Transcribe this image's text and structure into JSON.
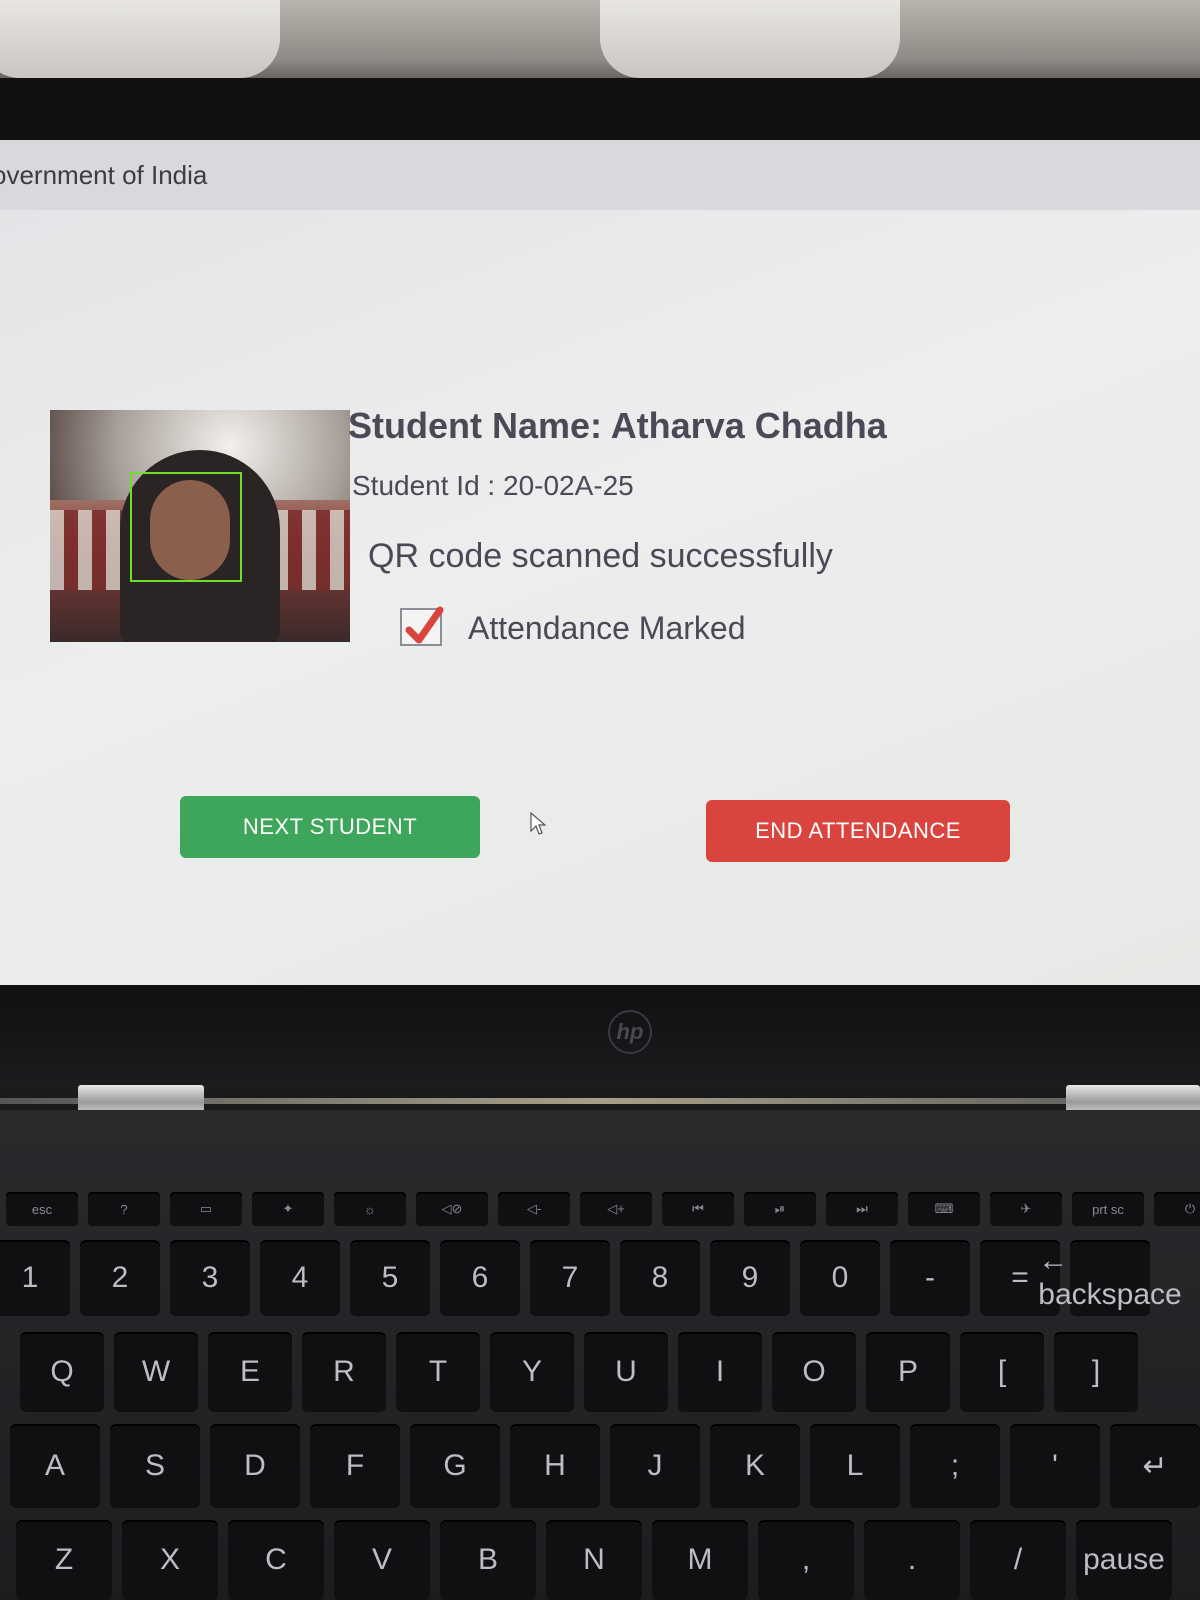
{
  "header": {
    "title": "overnment of India"
  },
  "student": {
    "name_line": "Student Name: Atharva Chadha",
    "id_line": "Student Id : 20-02A-25"
  },
  "status": {
    "qr_message": "QR code scanned successfully",
    "attendance_label": "Attendance Marked",
    "attendance_checked": true
  },
  "actions": {
    "next_label": "NEXT STUDENT",
    "end_label": "END ATTENDANCE"
  },
  "colors": {
    "next_button": "#3ea65a",
    "end_button": "#d9443e",
    "face_box": "#6ee02c",
    "check_mark": "#d9443e"
  },
  "keyboard": {
    "fn_row": [
      "esc",
      "?",
      "▭",
      "✦",
      "☼",
      "◁⊘",
      "◁-",
      "◁+",
      "⏮",
      "⏯",
      "⏭",
      "⌨",
      "✈",
      "prt sc",
      "⏻"
    ],
    "num_row": [
      "1",
      "2",
      "3",
      "4",
      "5",
      "6",
      "7",
      "8",
      "9",
      "0",
      "-",
      "=",
      "← backspace"
    ],
    "top_row": [
      "Q",
      "W",
      "E",
      "R",
      "T",
      "Y",
      "U",
      "I",
      "O",
      "P",
      "[",
      "]"
    ],
    "home_row": [
      "A",
      "S",
      "D",
      "F",
      "G",
      "H",
      "J",
      "K",
      "L",
      ";",
      "'",
      "↵"
    ],
    "bottom_row": [
      "Z",
      "X",
      "C",
      "V",
      "B",
      "N",
      "M",
      ",",
      ".",
      "/",
      "pause"
    ]
  }
}
